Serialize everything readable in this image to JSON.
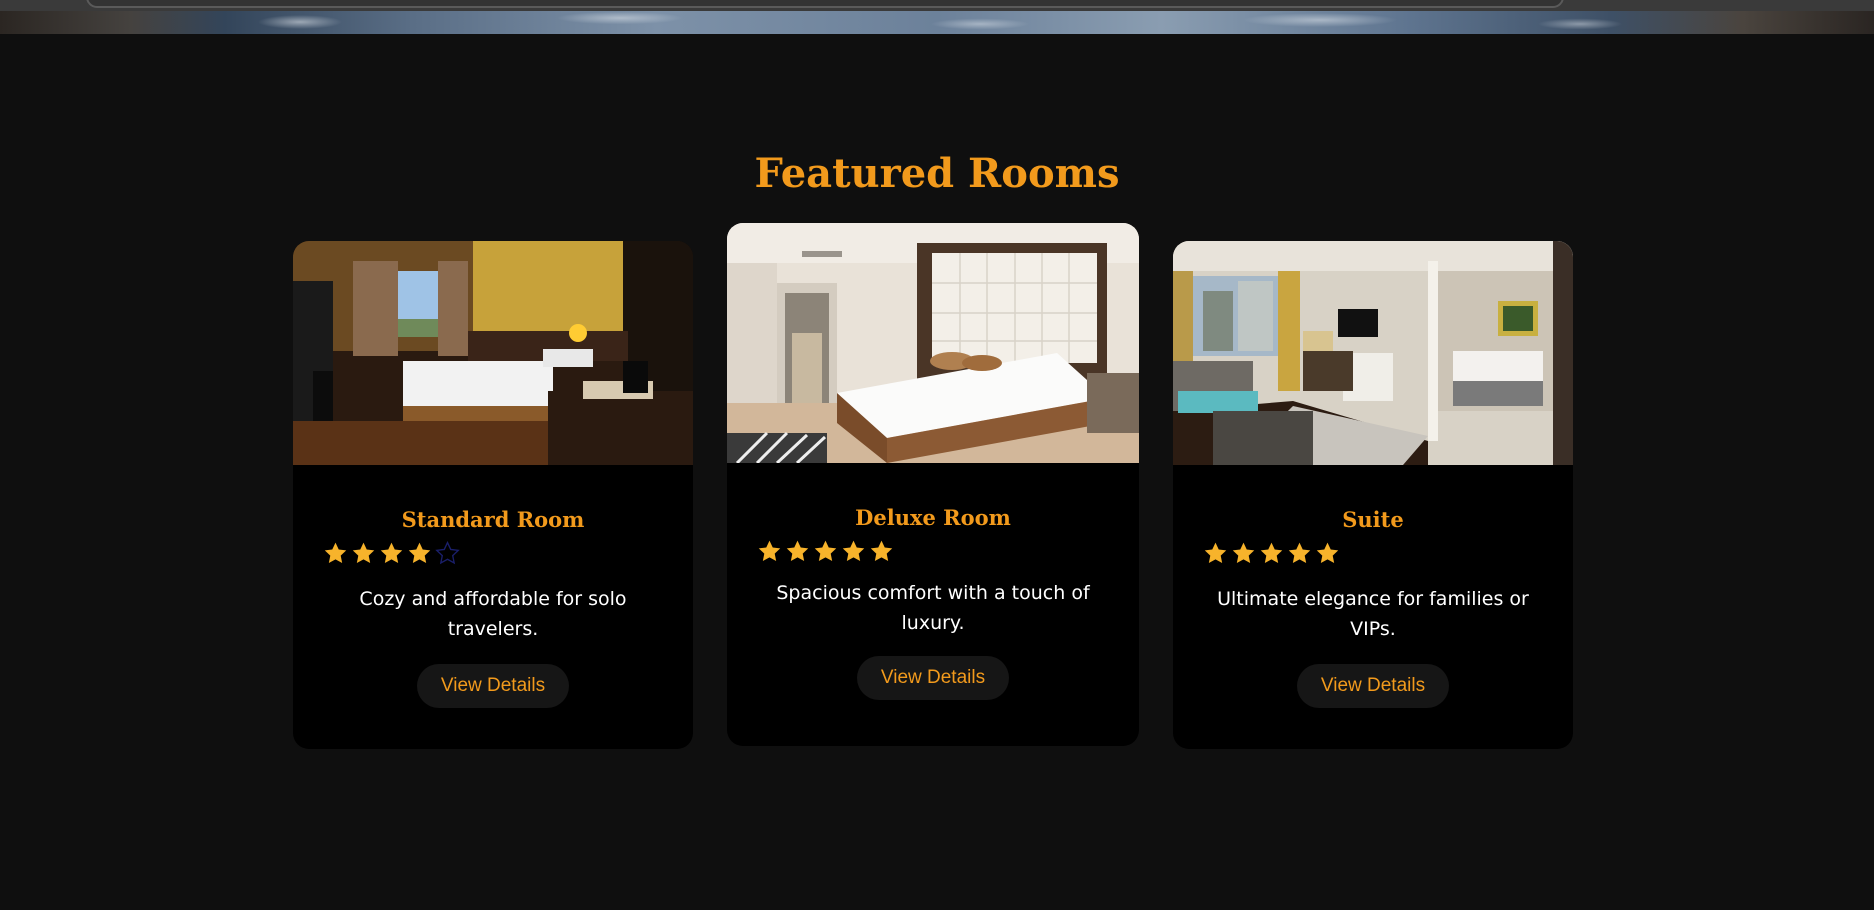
{
  "section": {
    "title": "Featured Rooms"
  },
  "rooms": [
    {
      "name": "Standard Room",
      "rating": 4,
      "rating_max": 5,
      "description": "Cozy and affordable for solo travelers.",
      "button_label": "View Details"
    },
    {
      "name": "Deluxe Room",
      "rating": 5,
      "rating_max": 5,
      "description": "Spacious comfort with a touch of luxury.",
      "button_label": "View Details"
    },
    {
      "name": "Suite",
      "rating": 5,
      "rating_max": 5,
      "description": "Ultimate elegance for families or VIPs.",
      "button_label": "View Details"
    }
  ],
  "colors": {
    "accent": "#f29a1c",
    "star_filled": "#f7b32b",
    "star_empty": "#1a1f6b",
    "background": "#0f0f0f",
    "card": "#000000"
  }
}
